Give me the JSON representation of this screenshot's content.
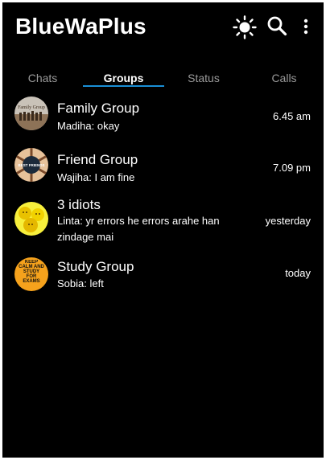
{
  "app": {
    "title": "BlueWaPlus"
  },
  "toolbar": {
    "theme_icon": "sun-icon",
    "search_icon": "search-icon",
    "menu_icon": "more-vertical-icon"
  },
  "tabs": [
    {
      "label": "Chats",
      "active": false
    },
    {
      "label": "Groups",
      "active": true
    },
    {
      "label": "Status",
      "active": false
    },
    {
      "label": "Calls",
      "active": false
    }
  ],
  "colors": {
    "background": "#000000",
    "accent": "#1a8fd6",
    "text": "#ffffff",
    "inactive_tab": "#9a9a9a"
  },
  "groups": [
    {
      "name": "Family Group",
      "last_message": "Madiha: okay",
      "time": "6.45 am",
      "avatar_text": "Family Group"
    },
    {
      "name": "Friend Group",
      "last_message": "Wajiha: I am fine",
      "time": "7.09 pm",
      "avatar_text": "BEST FRIENDS"
    },
    {
      "name": "3 idiots",
      "last_message": "Linta: yr errors he errors arahe han zindage mai",
      "time": "yesterday",
      "avatar_text": ""
    },
    {
      "name": "Study Group",
      "last_message": "Sobia: left",
      "time": "today",
      "avatar_text": "KEEP CALM AND STUDY FOR EXAMS"
    }
  ]
}
